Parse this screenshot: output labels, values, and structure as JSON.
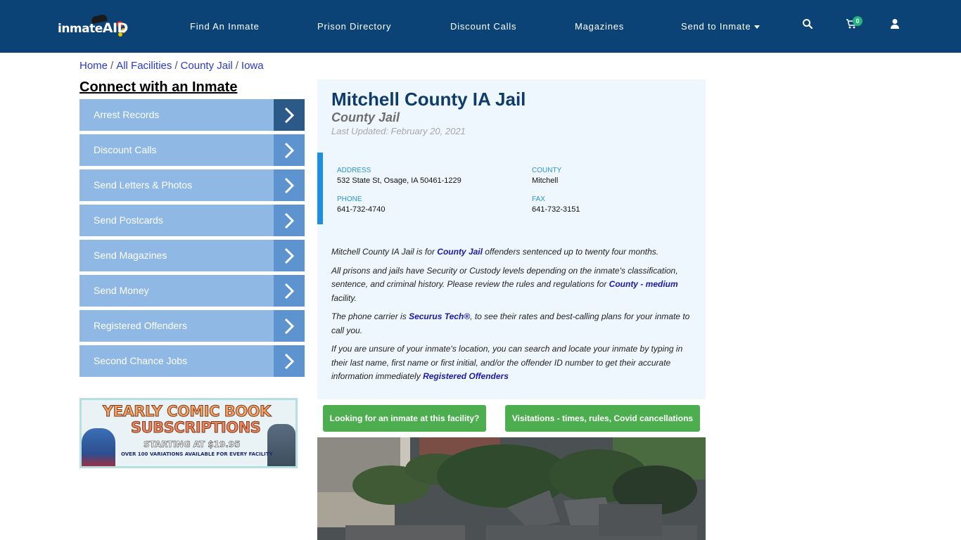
{
  "header": {
    "logo": {
      "text_main": "inmate",
      "text_accent": "AID",
      "alt": "inmateAID"
    },
    "nav": [
      {
        "label": "Find An Inmate"
      },
      {
        "label": "Prison Directory"
      },
      {
        "label": "Discount Calls"
      },
      {
        "label": "Magazines"
      },
      {
        "label": "Send to Inmate",
        "has_dropdown": true
      }
    ],
    "icons": {
      "search": "search-icon",
      "cart": "cart-icon",
      "user": "user-icon"
    },
    "cart_count": "0"
  },
  "breadcrumb": [
    {
      "label": "Home"
    },
    {
      "label": "All Facilities"
    },
    {
      "label": "County Jail"
    },
    {
      "label": "Iowa"
    }
  ],
  "breadcrumb_separator": "/",
  "sidebar": {
    "title": "Connect with an Inmate",
    "items": [
      {
        "label": "Arrest Records",
        "active": true
      },
      {
        "label": "Discount Calls"
      },
      {
        "label": "Send Letters & Photos"
      },
      {
        "label": "Send Postcards"
      },
      {
        "label": "Send Magazines"
      },
      {
        "label": "Send Money"
      },
      {
        "label": "Registered Offenders"
      },
      {
        "label": "Second Chance Jobs"
      }
    ],
    "ad": {
      "line1": "YEARLY COMIC BOOK",
      "line2": "SUBSCRIPTIONS",
      "line3": "STARTING AT $19.95",
      "line4": "OVER 100 VARIATIONS AVAILABLE FOR EVERY FACILITY"
    }
  },
  "facility": {
    "name": "Mitchell County IA Jail",
    "type": "County Jail",
    "last_updated": "Last Updated: February 20, 2021",
    "address_label": "ADDRESS",
    "address": "532 State St, Osage, IA 50461-1229",
    "county_label": "COUNTY",
    "county": "Mitchell",
    "phone_label": "PHONE",
    "phone": "641-732-4740",
    "fax_label": "FAX",
    "fax": "641-732-3151"
  },
  "description": {
    "p1_before": "Mitchell County IA Jail is for ",
    "p1_link": "County Jail",
    "p1_after": " offenders sentenced up to twenty four months.",
    "p2_before": "All prisons and jails have Security or Custody levels depending on the inmate's classification, sentence, and criminal history. Please review the rules and regulations for ",
    "p2_link": "County - medium",
    "p2_after": " facility.",
    "p3_before": "The phone carrier is ",
    "p3_link": "Securus Tech®",
    "p3_after": ", to see their rates and best-calling plans for your inmate to call you.",
    "p4_before": "If you are unsure of your inmate's location, you can search and locate your inmate by typing in their last name, first name or first initial, and/or the offender ID number to get their accurate information immediately ",
    "p4_link": "Registered Offenders"
  },
  "actions": {
    "find_inmate": "Looking for an inmate at this facility?",
    "visitations": "Visitations - times, rules, Covid cancellations"
  },
  "colors": {
    "header_bg": "#0b4376",
    "sidebar_item": "#8fb9e4",
    "sidebar_arrow": "#5d93cf",
    "sidebar_arrow_active": "#2c5a88",
    "title_blue": "#0e3b6b",
    "accent_blue": "#1a8fe3",
    "button_green": "#4cae4f",
    "cart_badge": "#24b47e"
  }
}
